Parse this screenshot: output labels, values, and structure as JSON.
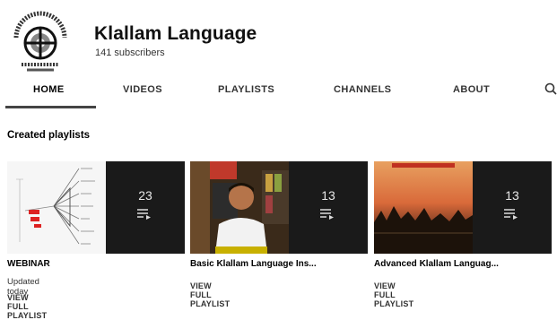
{
  "channel": {
    "name": "Klallam Language",
    "subscribers": "141 subscribers"
  },
  "tabs": [
    {
      "label": "HOME",
      "active": true
    },
    {
      "label": "VIDEOS"
    },
    {
      "label": "PLAYLISTS"
    },
    {
      "label": "CHANNELS"
    },
    {
      "label": "ABOUT"
    }
  ],
  "icons": {
    "logo": "klallam-seal-logo",
    "search": "search-icon",
    "playlist": "playlist-icon"
  },
  "section": {
    "title": "Created playlists"
  },
  "playlists": [
    {
      "title": "WEBINAR",
      "updated": "Updated today",
      "link": "VIEW FULL PLAYLIST",
      "count": "23"
    },
    {
      "title": "Basic Klallam Language Ins...",
      "link": "VIEW FULL PLAYLIST",
      "count": "13"
    },
    {
      "title": "Advanced Klallam Languag...",
      "link": "VIEW FULL PLAYLIST",
      "count": "13"
    }
  ]
}
